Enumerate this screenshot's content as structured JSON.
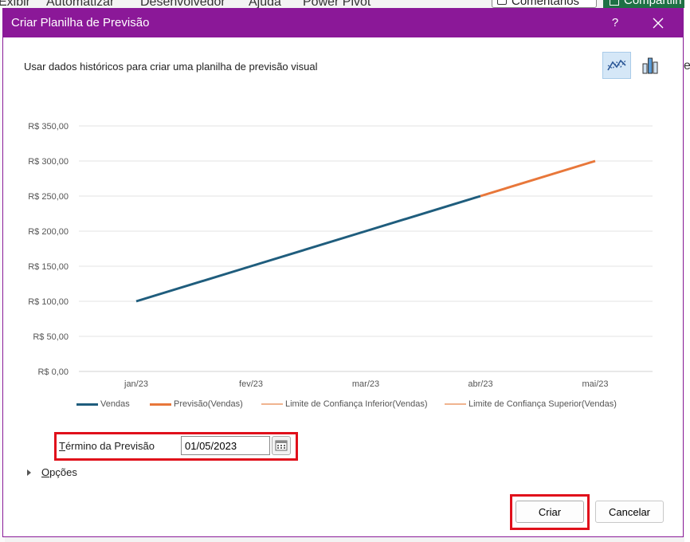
{
  "background": {
    "menu_items": [
      "Exibir",
      "Automatizar",
      "Desenvolvedor",
      "Ajuda",
      "Power Pivot"
    ],
    "comments_label": "Comentários",
    "share_label": "Compartilh",
    "right_edge_text": "e"
  },
  "dialog": {
    "title": "Criar Planilha de Previsão",
    "help_label": "?",
    "description": "Usar dados históricos para criar uma planilha de previsão visual",
    "chart_type_options": [
      "line-chart-icon",
      "column-chart-icon"
    ],
    "selected_chart_type": "line-chart-icon"
  },
  "chart_data": {
    "type": "line",
    "categories": [
      "jan/23",
      "fev/23",
      "mar/23",
      "abr/23",
      "mai/23"
    ],
    "y_ticks": [
      "R$ 0,00",
      "R$ 50,00",
      "R$ 100,00",
      "R$ 150,00",
      "R$ 200,00",
      "R$ 250,00",
      "R$ 300,00",
      "R$ 350,00"
    ],
    "ylim": [
      0,
      350
    ],
    "grid": true,
    "legend_position": "bottom",
    "series": [
      {
        "name": "Vendas",
        "color": "#1f5d7d",
        "values": [
          100,
          150,
          200,
          250,
          null
        ]
      },
      {
        "name": "Previsão(Vendas)",
        "color": "#e8773a",
        "values": [
          null,
          null,
          null,
          250,
          300
        ]
      },
      {
        "name": "Limite de Confiança Inferior(Vendas)",
        "color": "#f0b48f",
        "values": [
          null,
          null,
          null,
          null,
          null
        ]
      },
      {
        "name": "Limite de Confiança Superior(Vendas)",
        "color": "#f0b48f",
        "values": [
          null,
          null,
          null,
          null,
          null
        ]
      }
    ]
  },
  "forecast_end": {
    "label": "Término da Previsão",
    "value": "01/05/2023"
  },
  "options_label": "Opções",
  "buttons": {
    "create": "Criar",
    "cancel": "Cancelar"
  }
}
